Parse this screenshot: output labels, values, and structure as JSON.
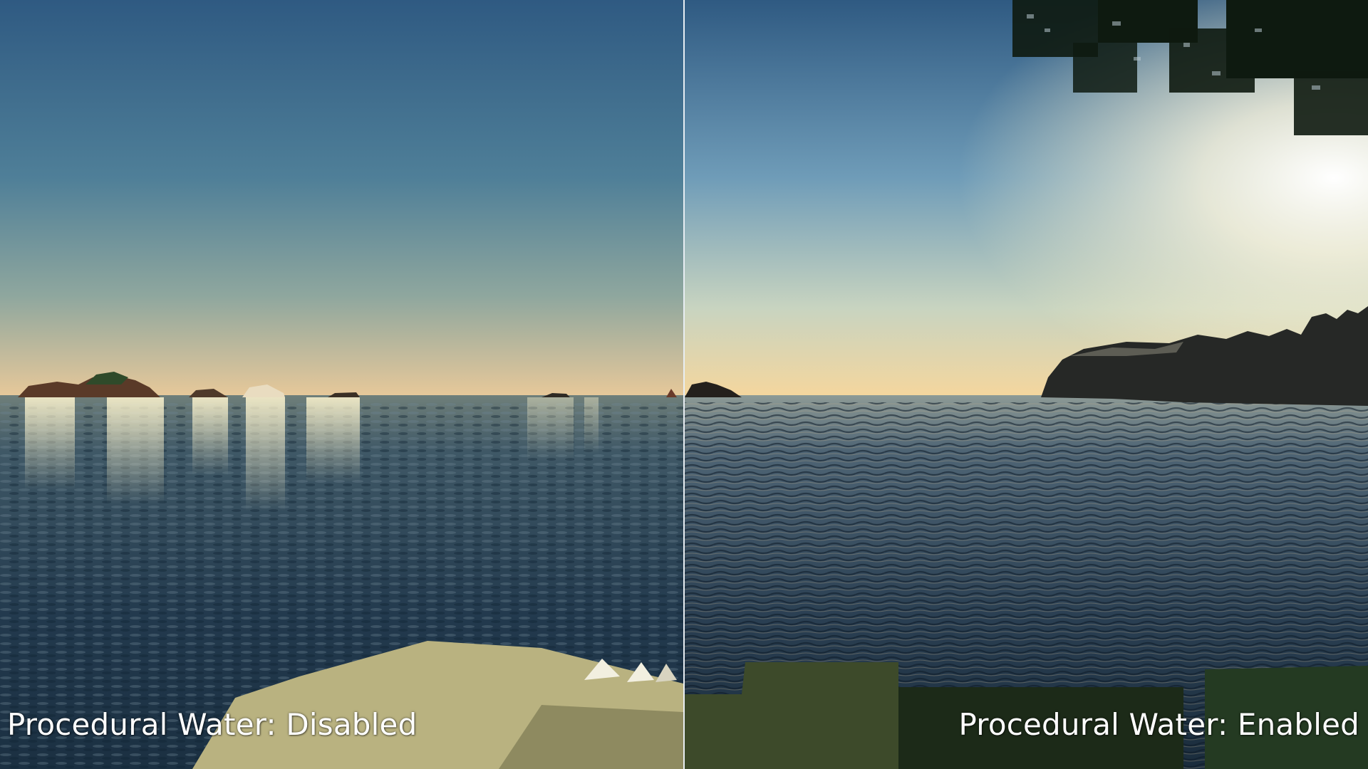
{
  "comparison": {
    "left_caption": "Procedural Water: Disabled",
    "right_caption": "Procedural Water: Enabled"
  },
  "colors": {
    "sky_top_left": "#2f5a82",
    "sky_horizon": "#e8c898",
    "water_deep": "#1e3548",
    "sun_glow": "#ffffff",
    "divider": "#e8eef3"
  }
}
